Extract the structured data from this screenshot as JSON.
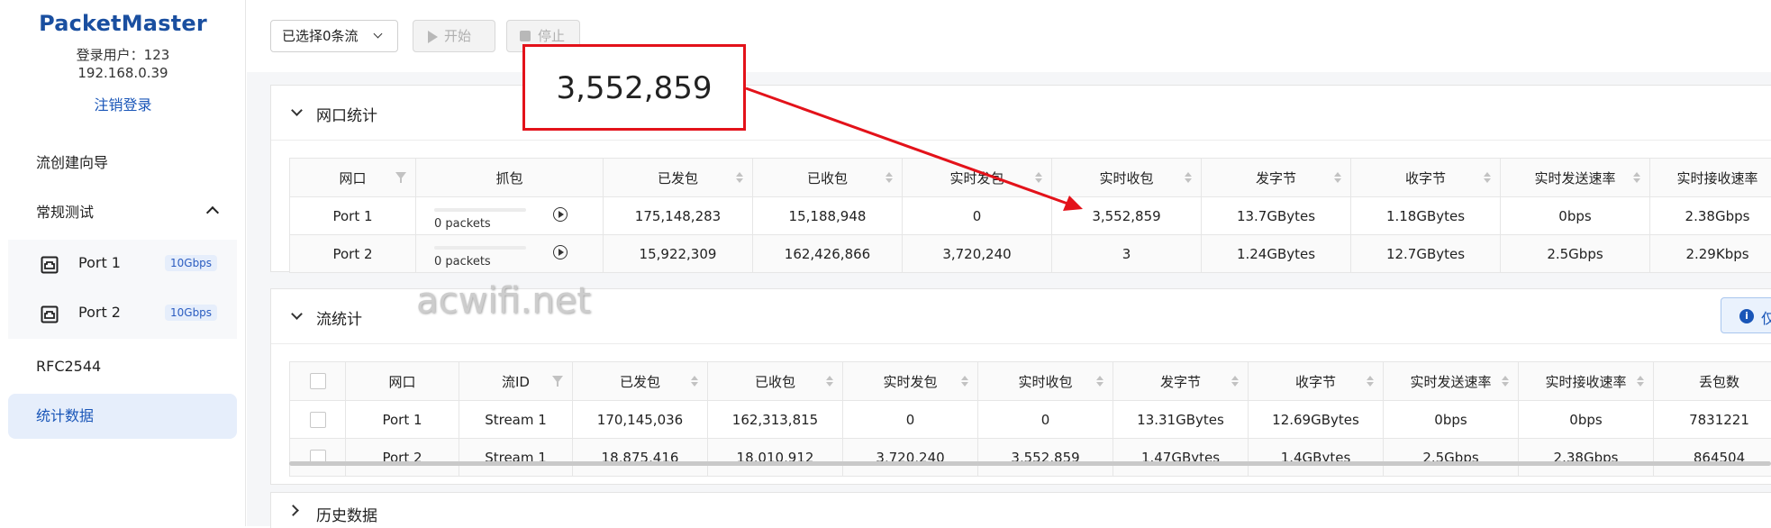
{
  "sidebar": {
    "brand": "PacketMaster",
    "user_line": "登录用户：123",
    "ip": "192.168.0.39",
    "logout": "注销登录",
    "items": [
      {
        "label": "流创建向导"
      },
      {
        "label": "常规测试"
      },
      {
        "label": "RFC2544"
      },
      {
        "label": "统计数据"
      }
    ],
    "ports": [
      {
        "label": "Port 1",
        "speed": "10Gbps"
      },
      {
        "label": "Port 2",
        "speed": "10Gbps"
      }
    ]
  },
  "toolbar": {
    "selection": "已选择0条流",
    "start": "开始",
    "stop": "停止"
  },
  "port_stats": {
    "title": "网口统计",
    "columns": [
      "网口",
      "抓包",
      "已发包",
      "已收包",
      "实时发包",
      "实时收包",
      "发字节",
      "收字节",
      "实时发送速率",
      "实时接收速率"
    ],
    "rows": [
      {
        "port": "Port 1",
        "capture": "0 packets",
        "tx": "175,148,283",
        "rx": "15,188,948",
        "rt_tx": "0",
        "rt_rx": "3,552,859",
        "tx_bytes": "13.7GBytes",
        "rx_bytes": "1.18GBytes",
        "tx_rate": "0bps",
        "rx_rate": "2.38Gbps"
      },
      {
        "port": "Port 2",
        "capture": "0 packets",
        "tx": "15,922,309",
        "rx": "162,426,866",
        "rt_tx": "3,720,240",
        "rt_rx": "3",
        "tx_bytes": "1.24GBytes",
        "rx_bytes": "12.7GBytes",
        "tx_rate": "2.5Gbps",
        "rx_rate": "2.29Kbps"
      }
    ]
  },
  "stream_stats": {
    "title": "流统计",
    "info_button": "仅",
    "columns": [
      "网口",
      "流ID",
      "已发包",
      "已收包",
      "实时发包",
      "实时收包",
      "发字节",
      "收字节",
      "实时发送速率",
      "实时接收速率",
      "丢包数"
    ],
    "rows": [
      {
        "port": "Port 1",
        "stream": "Stream 1",
        "tx": "170,145,036",
        "rx": "162,313,815",
        "rt_tx": "0",
        "rt_rx": "0",
        "tx_bytes": "13.31GBytes",
        "rx_bytes": "12.69GBytes",
        "tx_rate": "0bps",
        "rx_rate": "0bps",
        "loss": "7831221"
      },
      {
        "port": "Port 2",
        "stream": "Stream 1",
        "tx": "18,875,416",
        "rx": "18,010,912",
        "rt_tx": "3,720,240",
        "rt_rx": "3,552,859",
        "tx_bytes": "1.47GBytes",
        "rx_bytes": "1.4GBytes",
        "tx_rate": "2.5Gbps",
        "rx_rate": "2.38Gbps",
        "loss": "864504"
      }
    ]
  },
  "history": {
    "title": "历史数据"
  },
  "watermark": "acwifi.net",
  "annotation": {
    "value": "3,552,859",
    "color": "#e3121a"
  }
}
